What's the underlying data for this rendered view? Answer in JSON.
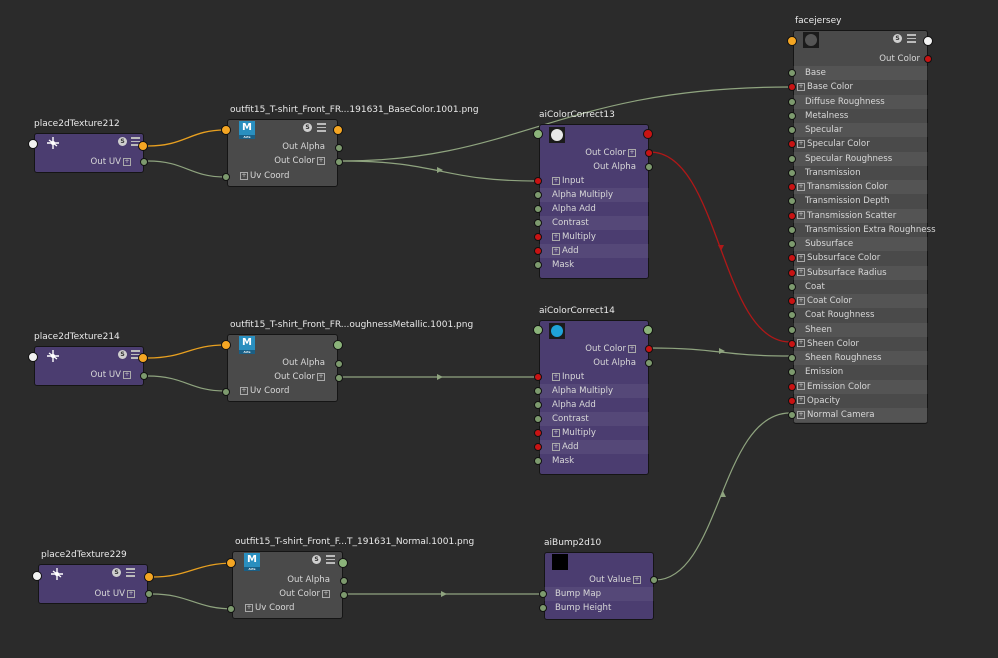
{
  "colors": {
    "background": "#2b2b2b",
    "purple_node": "#4b3d70",
    "grey_node": "#4a4a4a",
    "wire_green": "#8fa47f",
    "wire_orange": "#e8a020",
    "wire_red": "#b01818"
  },
  "icons": {
    "solo": "S",
    "file": "M",
    "file_sub": "Arts"
  },
  "nodes": {
    "place212": {
      "title": "place2dTexture212",
      "out_uv": "Out UV"
    },
    "place214": {
      "title": "place2dTexture214",
      "out_uv": "Out UV"
    },
    "place229": {
      "title": "place2dTexture229",
      "out_uv": "Out UV"
    },
    "file1": {
      "title": "outfit15_T-shirt_Front_FR...191631_BaseColor.1001.png",
      "out_alpha": "Out Alpha",
      "out_color": "Out Color",
      "uv_coord": "Uv Coord"
    },
    "file2": {
      "title": "outfit15_T-shirt_Front_FR...oughnessMetallic.1001.png",
      "out_alpha": "Out Alpha",
      "out_color": "Out Color",
      "uv_coord": "Uv Coord"
    },
    "file3": {
      "title": "outfit15_T-shirt_Front_F...T_191631_Normal.1001.png",
      "out_alpha": "Out Alpha",
      "out_color": "Out Color",
      "uv_coord": "Uv Coord"
    },
    "cc13": {
      "title": "aiColorCorrect13",
      "out_color": "Out Color",
      "out_alpha": "Out Alpha",
      "inputs": [
        "Input",
        "Alpha Multiply",
        "Alpha Add",
        "Contrast",
        "Multiply",
        "Add",
        "Mask"
      ]
    },
    "cc14": {
      "title": "aiColorCorrect14",
      "out_color": "Out Color",
      "out_alpha": "Out Alpha",
      "inputs": [
        "Input",
        "Alpha Multiply",
        "Alpha Add",
        "Contrast",
        "Multiply",
        "Add",
        "Mask"
      ]
    },
    "bump": {
      "title": "aiBump2d10",
      "out_value": "Out Value",
      "inputs": [
        "Bump Map",
        "Bump Height"
      ]
    },
    "face": {
      "title": "facejersey",
      "out_color": "Out Color",
      "inputs": [
        "Base",
        "Base Color",
        "Diffuse Roughness",
        "Metalness",
        "Specular",
        "Specular Color",
        "Specular Roughness",
        "Transmission",
        "Transmission Color",
        "Transmission Depth",
        "Transmission Scatter",
        "Transmission Extra Roughness",
        "Subsurface",
        "Subsurface Color",
        "Subsurface Radius",
        "Coat",
        "Coat Color",
        "Coat Roughness",
        "Sheen",
        "Sheen Color",
        "Sheen Roughness",
        "Emission",
        "Emission Color",
        "Opacity",
        "Normal Camera"
      ]
    }
  }
}
